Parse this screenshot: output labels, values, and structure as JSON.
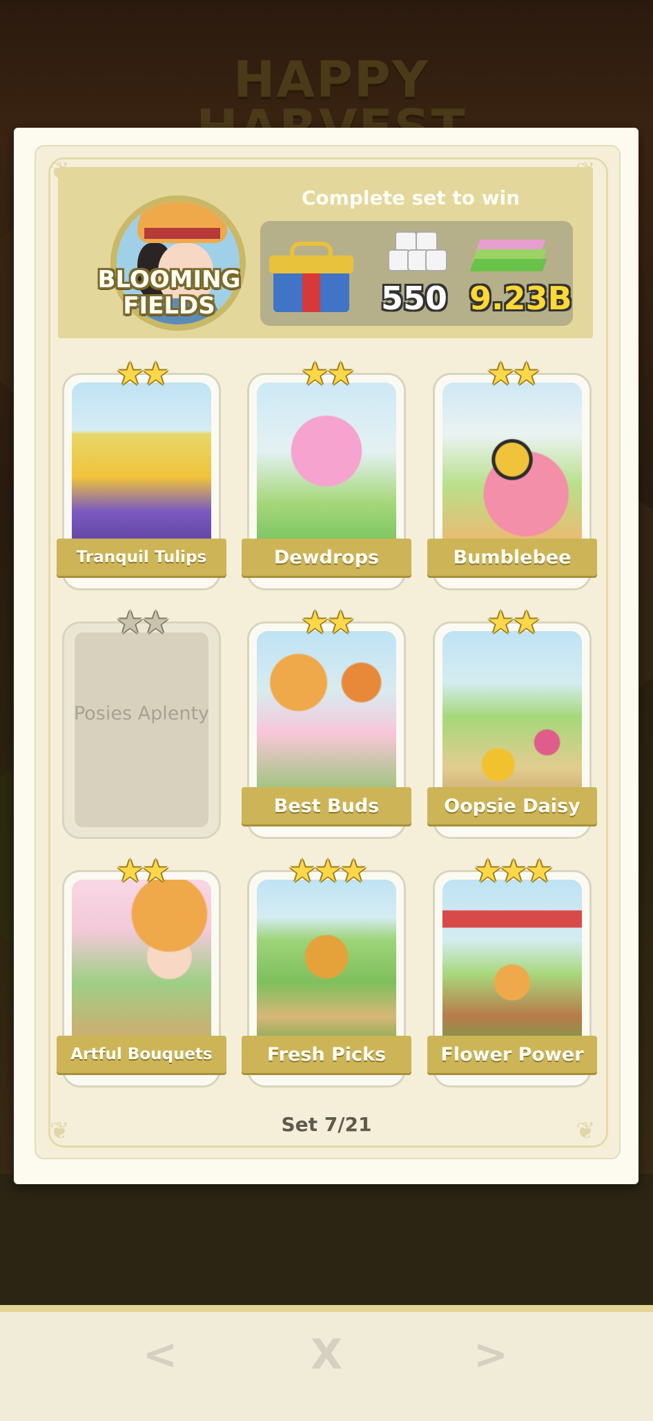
{
  "background": {
    "event_title": "HAPPY HARVEST"
  },
  "header": {
    "set_name": "BLOOMING FIELDS",
    "complete_text": "Complete set to win",
    "rewards": {
      "dice_count": "550",
      "cash_amount": "9.23B"
    }
  },
  "cards": [
    {
      "name": "Tranquil Tulips",
      "stars": 2,
      "collected": true
    },
    {
      "name": "Dewdrops",
      "stars": 2,
      "collected": true
    },
    {
      "name": "Bumblebee",
      "stars": 2,
      "collected": true
    },
    {
      "name": "Posies Aplenty",
      "stars": 2,
      "collected": false
    },
    {
      "name": "Best Buds",
      "stars": 2,
      "collected": true
    },
    {
      "name": "Oopsie Daisy",
      "stars": 2,
      "collected": true
    },
    {
      "name": "Artful Bouquets",
      "stars": 2,
      "collected": true
    },
    {
      "name": "Fresh Picks",
      "stars": 3,
      "collected": true
    },
    {
      "name": "Flower Power",
      "stars": 3,
      "collected": true
    }
  ],
  "footer": {
    "set_label": "Set 7/21",
    "prev": "<",
    "close": "X",
    "next": ">"
  },
  "colors": {
    "banner": "#cdb557",
    "header_bg": "#e4d79b",
    "star": "#ffd84a"
  }
}
